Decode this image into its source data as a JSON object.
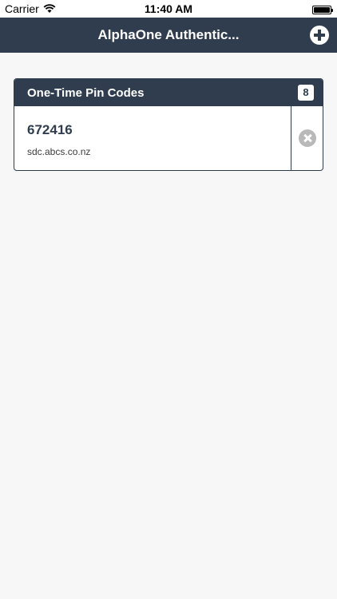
{
  "status_bar": {
    "carrier": "Carrier",
    "time": "11:40 AM",
    "wifi_icon": "wifi-icon",
    "battery_icon": "battery-icon"
  },
  "nav": {
    "title": "AlphaOne Authentic...",
    "add_icon": "plus-icon"
  },
  "panel": {
    "title": "One-Time Pin Codes",
    "count": "8",
    "items": [
      {
        "pin": "672416",
        "domain": "sdc.abcs.co.nz",
        "delete_icon": "close-icon"
      }
    ]
  },
  "colors": {
    "nav_bg": "#2f3d4f",
    "page_bg": "#f7f7f7",
    "delete_icon": "#b9b9b9"
  }
}
